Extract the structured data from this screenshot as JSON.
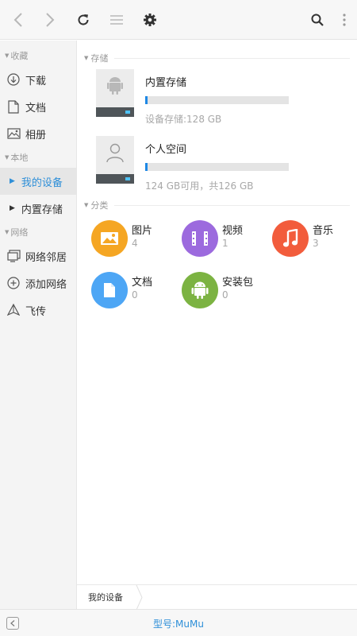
{
  "toolbar": {
    "icons": [
      "back-icon",
      "forward-icon",
      "refresh-icon",
      "list-view-icon",
      "settings-icon",
      "search-icon",
      "more-icon"
    ]
  },
  "sidebar": {
    "favorites_header": "收藏",
    "favorites": [
      {
        "label": "下载",
        "icon": "download-icon"
      },
      {
        "label": "文档",
        "icon": "document-icon"
      },
      {
        "label": "相册",
        "icon": "album-icon"
      }
    ],
    "local_header": "本地",
    "local": [
      {
        "label": "我的设备",
        "active": true
      },
      {
        "label": "内置存储",
        "active": false
      }
    ],
    "network_header": "网络",
    "network": [
      {
        "label": "网络邻居",
        "icon": "network-neighborhood-icon"
      },
      {
        "label": "添加网络",
        "icon": "add-network-icon"
      },
      {
        "label": "飞传",
        "icon": "fly-transfer-icon"
      }
    ]
  },
  "main": {
    "storage_header": "存储",
    "storages": [
      {
        "name": "内置存储",
        "info": "设备存储:128 GB",
        "usage": 0.01,
        "icon": "android-storage-icon"
      },
      {
        "name": "个人空间",
        "info": "124 GB可用，共126 GB",
        "usage": 0.015,
        "icon": "person-storage-icon"
      }
    ],
    "category_header": "分类",
    "categories": [
      {
        "label": "图片",
        "count": "4",
        "color": "#f5a623",
        "icon": "image-icon"
      },
      {
        "label": "视频",
        "count": "1",
        "color": "#9c6ade",
        "icon": "video-icon"
      },
      {
        "label": "音乐",
        "count": "3",
        "color": "#f25c3c",
        "icon": "music-icon"
      },
      {
        "label": "文档",
        "count": "0",
        "color": "#4da6f5",
        "icon": "document-icon"
      },
      {
        "label": "安装包",
        "count": "0",
        "color": "#7cb342",
        "icon": "apk-icon"
      }
    ]
  },
  "breadcrumb": {
    "items": [
      "我的设备"
    ]
  },
  "bottom_bar": {
    "model": "型号:MuMu"
  },
  "colors": {
    "accent": "#2e8fd8",
    "progress": "#1e88e5"
  }
}
